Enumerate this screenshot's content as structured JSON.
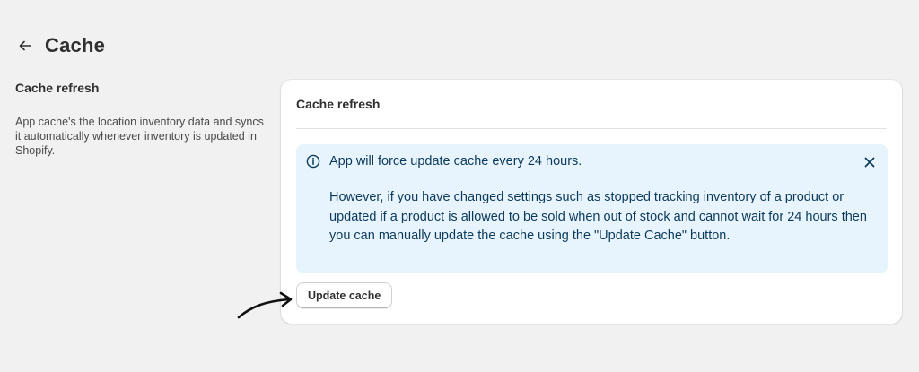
{
  "header": {
    "back_icon": "arrow-left-icon",
    "title": "Cache"
  },
  "section": {
    "title": "Cache refresh",
    "description": "App cache's the location inventory data and syncs it automatically whenever inventory is updated in Shopify."
  },
  "card": {
    "title": "Cache refresh",
    "banner": {
      "icon": "info-circle-icon",
      "title": "App will force update cache every 24 hours.",
      "body": "However, if you have changed settings such as stopped tracking inventory of a product or updated if a product is allowed to be sold when out of stock and cannot wait for 24 hours then you can manually update the cache using the \"Update Cache\" button.",
      "dismiss_icon": "close-icon",
      "background_color": "#e8f4fd",
      "text_color": "#0b3a5b"
    },
    "button_label": "Update cache"
  },
  "annotation": {
    "icon": "curved-arrow-icon"
  },
  "colors": {
    "page_background": "#f1f1f1",
    "card_background": "#ffffff",
    "text_primary": "#303030"
  }
}
